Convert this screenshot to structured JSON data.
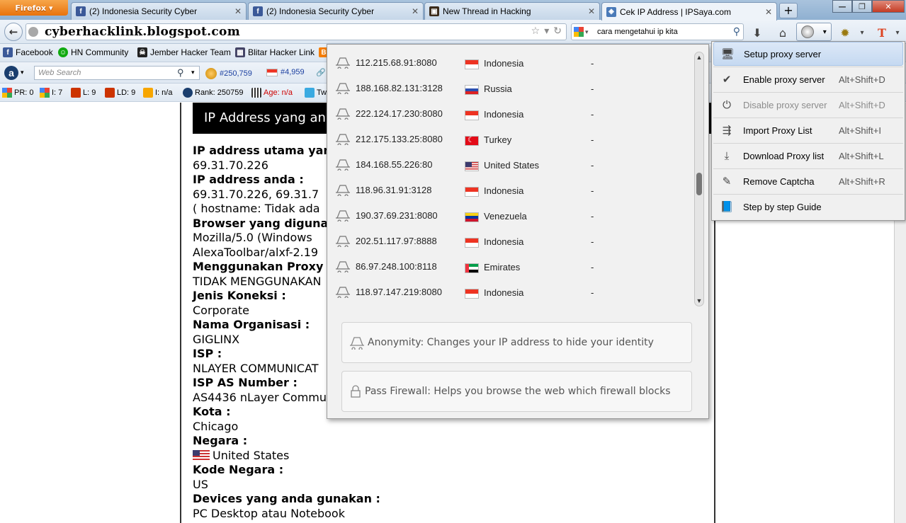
{
  "tabs": [
    {
      "label": "(2) Indonesia Security Cyber",
      "icon": "facebook-icon"
    },
    {
      "label": "(2) Indonesia Security Cyber",
      "icon": "facebook-icon"
    },
    {
      "label": "New Thread in Hacking",
      "icon": "forum-icon"
    },
    {
      "label": "Cek IP Address | IPSaya.com",
      "icon": "network-icon"
    }
  ],
  "firefox_label": "Firefox",
  "url": "cyberhacklink.blogspot.com",
  "search_query": "cara mengetahui ip kita",
  "bookmarks": [
    {
      "label": "Facebook"
    },
    {
      "label": "HN Community"
    },
    {
      "label": "Jember Hacker Team"
    },
    {
      "label": "Blitar Hacker Link"
    }
  ],
  "alexa": {
    "search_placeholder": "Web Search",
    "rank_global": "#250,759",
    "rank_country": "#4,959"
  },
  "stats": {
    "pr": "PR: 0",
    "i": "I: 7",
    "l": "L: 9",
    "ld": "LD: 9",
    "in": "I: n/a",
    "rank": "Rank: 250759",
    "age": "Age: n/a",
    "tw": "Tw"
  },
  "page": {
    "header": "IP Address yang and",
    "rows": [
      {
        "label": "IP address utama yan",
        "value": "69.31.70.226"
      },
      {
        "label": "IP address anda :",
        "value": "69.31.70.226, 69.31.7",
        "extra": "( hostname: Tidak ada"
      },
      {
        "label": "Browser yang digunak",
        "value": "Mozilla/5.0 (Windows",
        "extra": "AlexaToolbar/alxf-2.19"
      },
      {
        "label": "Menggunakan Proxy ?",
        "value": "TIDAK MENGGUNAKAN"
      },
      {
        "label": "Jenis Koneksi :",
        "value": "Corporate"
      },
      {
        "label": "Nama Organisasi :",
        "value": "GIGLINX"
      },
      {
        "label": "ISP :",
        "value": "NLAYER COMMUNICAT"
      },
      {
        "label": "ISP AS Number :",
        "value": "AS4436 nLayer Commu"
      },
      {
        "label": "Kota :",
        "value": "Chicago"
      },
      {
        "label": "Negara :",
        "value": "United States"
      },
      {
        "label": "Kode Negara :",
        "value": "US"
      },
      {
        "label": "Devices yang anda gunakan :",
        "value": "PC Desktop atau Notebook"
      }
    ]
  },
  "proxies": [
    {
      "address": "112.215.68.91:8080",
      "country": "Indonesia",
      "flag": "id",
      "extra": "-"
    },
    {
      "address": "188.168.82.131:3128",
      "country": "Russia",
      "flag": "ru",
      "extra": "-"
    },
    {
      "address": "222.124.17.230:8080",
      "country": "Indonesia",
      "flag": "id",
      "extra": "-"
    },
    {
      "address": "212.175.133.25:8080",
      "country": "Turkey",
      "flag": "tr",
      "extra": "-"
    },
    {
      "address": "184.168.55.226:80",
      "country": "United States",
      "flag": "us",
      "extra": "-"
    },
    {
      "address": "118.96.31.91:3128",
      "country": "Indonesia",
      "flag": "id",
      "extra": "-"
    },
    {
      "address": "190.37.69.231:8080",
      "country": "Venezuela",
      "flag": "ve",
      "extra": "-"
    },
    {
      "address": "202.51.117.97:8888",
      "country": "Indonesia",
      "flag": "id",
      "extra": "-"
    },
    {
      "address": "86.97.248.100:8118",
      "country": "Emirates",
      "flag": "ae",
      "extra": "-"
    },
    {
      "address": "118.97.147.219:8080",
      "country": "Indonesia",
      "flag": "id",
      "extra": "-"
    }
  ],
  "features": [
    {
      "text": "Anonymity: Changes your IP address to hide your identity",
      "icon": "incognito-icon"
    },
    {
      "text": "Pass Firewall: Helps you browse the web which firewall blocks",
      "icon": "lock-icon"
    }
  ],
  "menu": [
    {
      "label": "Setup proxy server",
      "shortcut": "",
      "icon": "monitor-icon",
      "highlighted": true,
      "disabled": false
    },
    {
      "label": "Enable proxy server",
      "shortcut": "Alt+Shift+D",
      "icon": "check-icon",
      "highlighted": false,
      "disabled": false
    },
    {
      "label": "Disable proxy server",
      "shortcut": "Alt+Shift+D",
      "icon": "power-icon",
      "highlighted": false,
      "disabled": true
    },
    {
      "label": "Import Proxy List",
      "shortcut": "Alt+Shift+I",
      "icon": "import-icon",
      "highlighted": false,
      "disabled": false
    },
    {
      "label": "Download Proxy list",
      "shortcut": "Alt+Shift+L",
      "icon": "download-icon",
      "highlighted": false,
      "disabled": false
    },
    {
      "label": "Remove Captcha",
      "shortcut": "Alt+Shift+R",
      "icon": "captcha-icon",
      "highlighted": false,
      "disabled": false
    },
    {
      "label": "Step by step Guide",
      "shortcut": "",
      "icon": "book-icon",
      "highlighted": false,
      "disabled": false
    }
  ]
}
